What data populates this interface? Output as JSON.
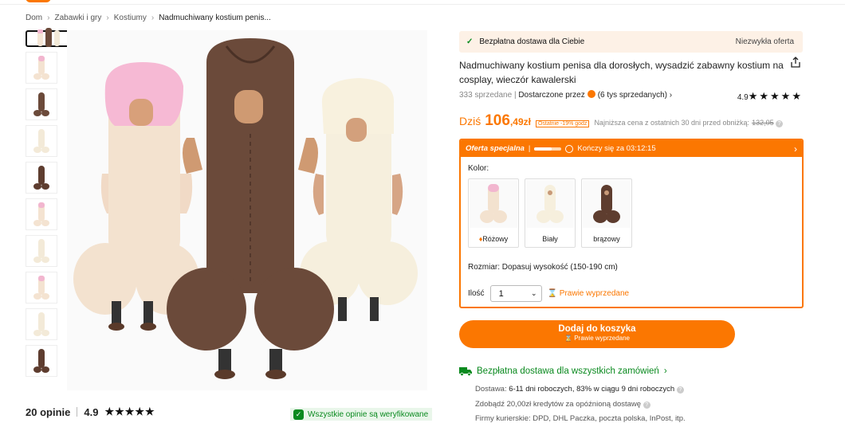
{
  "breadcrumb": [
    "Dom",
    "Zabawki i gry",
    "Kostiumy",
    "Nadmuchiwany kostium penis..."
  ],
  "reviews": {
    "count_label": "20 opinie",
    "rating": "4.9",
    "verified": "Wszystkie opinie są weryfikowane"
  },
  "shipping_banner": {
    "left": "Bezpłatna dostawa dla Ciebie",
    "right": "Niezwykła oferta"
  },
  "product": {
    "title": "Nadmuchiwany kostium penisa dla dorosłych, wysadzić zabawny kostium na cosplay, wieczór kawalerski",
    "sold": "333 sprzedane",
    "delivered_by": "Dostarczone przez",
    "seller_sold": "(6 tys sprzedanych)",
    "rating": "4.9"
  },
  "price": {
    "prefix": "Dziś",
    "main": "106",
    "fraction": ",49zł",
    "tag": "Ostatnie -19% godz",
    "lowest_note": "Najniższa cena z ostatnich 30 dni przed obniżką:",
    "old": "132,05"
  },
  "special_offer": {
    "label": "Oferta specjalna",
    "sep": "|",
    "ends": "Kończy się za 03:12:15",
    "progress": 0.65
  },
  "color": {
    "label": "Kolor:",
    "options": [
      {
        "name": "Różowy",
        "hot": true
      },
      {
        "name": "Biały",
        "hot": false
      },
      {
        "name": "brązowy",
        "hot": false
      }
    ]
  },
  "size": {
    "label": "Rozmiar:",
    "value": "Dopasuj wysokość (150-190 cm)"
  },
  "quantity": {
    "label": "Ilość",
    "value": "1",
    "hot": "Prawie wyprzedane"
  },
  "cart": {
    "label": "Dodaj do koszyka",
    "sub": "Prawie wyprzedane"
  },
  "delivery": {
    "free_all": "Bezpłatna dostawa dla wszystkich zamówień",
    "line1_label": "Dostawa:",
    "line1_value": "6-11 dni roboczych, 83% w ciągu 9 dni roboczych",
    "line2": "Zdobądź 20,00zł kredytów za opóźnioną dostawę",
    "line3": "Firmy kurierskie: DPD, DHL Paczka, poczta polska, InPost, itp."
  },
  "colors": {
    "accent": "#fb7701",
    "green": "#0a8a1f"
  }
}
